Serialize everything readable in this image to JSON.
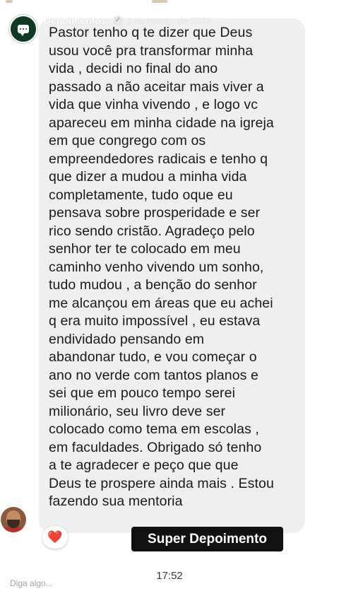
{
  "story": {
    "username": "Depoimentos",
    "verified_icon": "verified-badge-icon",
    "date": "1 de janeiro de 2023",
    "close_icon": "close-icon"
  },
  "message": {
    "text": "Pastor tenho q te dizer que Deus\nusou você pra transformar minha\nvida , decidi no final do ano\npassado a não aceitar mais viver a\nvida que vinha vivendo , e logo vc\napareceu em minha cidade na igreja\nem que congrego com os\nempreendedores radicais e tenho q\nque dizer a mudou a minha vida\ncompletamente, tudo oque eu\npensava sobre prosperidade e ser\nrico sendo cristão. Agradeço pelo\nsenhor ter te colocado em meu\ncaminho venho vivendo um sonho,\ntudo mudou , a benção do senhor\nme alcançou em áreas que eu achei\nq era muito impossível , eu estava\nendividado pensando em\nabandonar tudo,  e vou começar o\nano no verde com tantos planos e\nsei que em pouco tempo serei\nmilionário, seu livro deve ser\ncolocado como tema em escolas ,\nem faculdades. Obrigado só tenho\na te agradecer e peço que que\nDeus te prospere ainda mais . Estou\nfazendo sua mentoria",
    "reaction": "❤️"
  },
  "sticker_label": "Super Depoimento",
  "footer": {
    "time": "17:52",
    "reply_placeholder": "Diga algo..."
  },
  "colors": {
    "bubble": "#efefef",
    "badge_bg": "#111111",
    "avatar_bg": "#0d3b26"
  }
}
